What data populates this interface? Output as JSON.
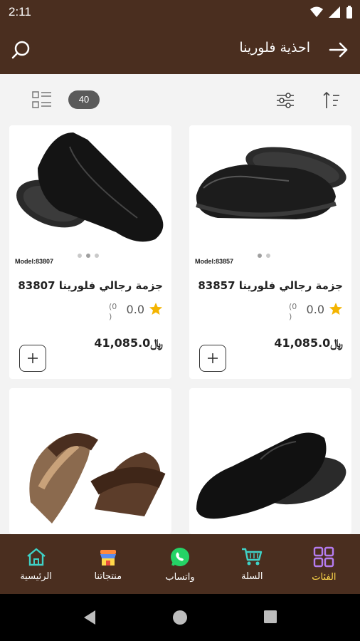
{
  "status": {
    "time": "2:11"
  },
  "appbar": {
    "title": "احذية فلورينا"
  },
  "toolbar": {
    "count": "40"
  },
  "products": [
    {
      "model": "Model:83857",
      "name": "جزمة رجالي فلورينا 83857",
      "rating": "0.0",
      "reviews": "(0\n)",
      "price": "41,085.0﷼"
    },
    {
      "model": "Model:83807",
      "name": "جزمة رجالي فلورينا 83807",
      "rating": "0.0",
      "reviews": "(0\n)",
      "price": "41,085.0﷼"
    }
  ],
  "nav": [
    {
      "label": "الرئيسية",
      "icon": "home-icon"
    },
    {
      "label": "منتجاتنا",
      "icon": "store-icon"
    },
    {
      "label": "واتساب",
      "icon": "whatsapp-icon"
    },
    {
      "label": "السلة",
      "icon": "cart-icon"
    },
    {
      "label": "الفئات",
      "icon": "grid-icon"
    }
  ],
  "colors": {
    "brand": "#4a2e1f",
    "active": "#ffd84a",
    "star": "#f4b400"
  }
}
